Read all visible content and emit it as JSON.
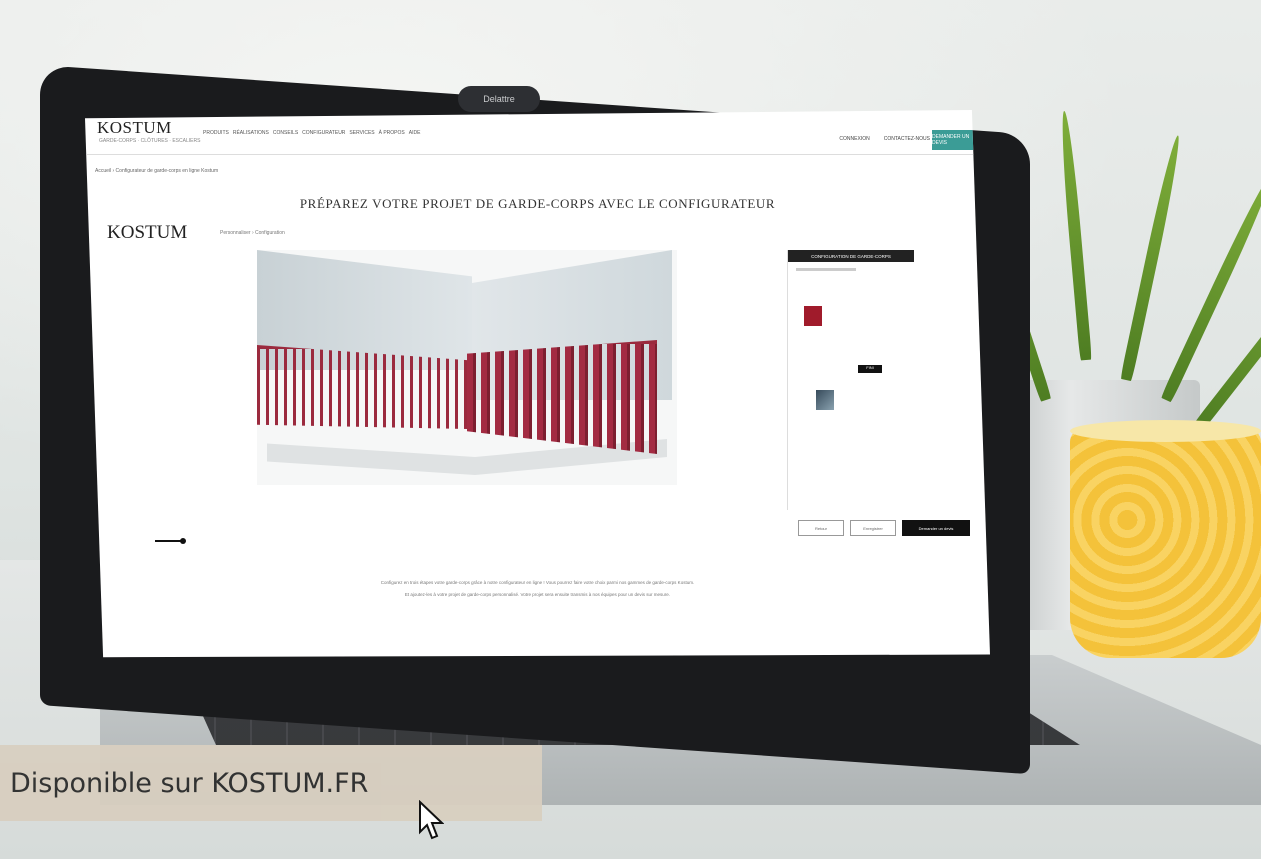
{
  "camera_label": "Delattre",
  "site": {
    "logo": "KOSTUM",
    "logo_subtitle": "GARDE-CORPS · CLÔTURES · ESCALIERS",
    "nav_links": [
      "PRODUITS",
      "RÉALISATIONS",
      "CONSEILS",
      "CONFIGURATEUR",
      "SERVICES",
      "À PROPOS",
      "AIDE"
    ],
    "nav_right": [
      "CONNEXION",
      "CONTACTEZ-NOUS"
    ],
    "cta_top": "DEMANDER UN DEVIS",
    "breadcrumb": "Accueil › Configurateur de garde-corps en ligne Kostum",
    "page_title": "PRÉPAREZ VOTRE PROJET DE GARDE-CORPS AVEC LE CONFIGURATEUR",
    "configurator_logo": "KOSTUM",
    "configurator_crumb": "Personnaliser › Configuration"
  },
  "side_panel": {
    "title": "CONFIGURATION DE GARDE-CORPS",
    "active_tab": "FINI"
  },
  "buttons": {
    "back": "Retour",
    "save": "Enregistrer",
    "quote": "Demander un devis"
  },
  "footer": {
    "line1": "Configurez en trois étapes votre garde-corps grâce à notre configurateur en ligne ! Vous pourrez faire votre choix parmi nos gammes de garde-corps Kostum.",
    "line2": "Et ajoutez-les à votre projet de garde-corps personnalisé. Votre projet sera ensuite transmis à nos équipes pour un devis sur mesure."
  },
  "banner": {
    "text": "Disponible sur KOSTUM.FR"
  },
  "colors": {
    "accent": "#3b9c96",
    "railing": "#9b2a3e",
    "banner_bg": "#d8cfc0"
  }
}
